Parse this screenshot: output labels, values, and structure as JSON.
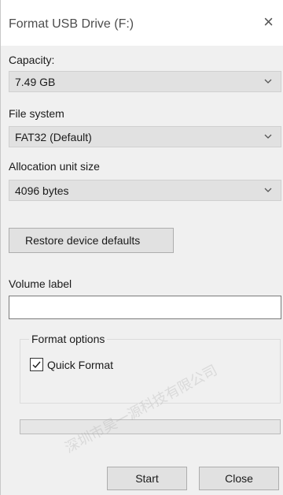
{
  "dialog": {
    "title": "Format USB Drive (F:)",
    "close_glyph": "×"
  },
  "capacity": {
    "label": "Capacity:",
    "value": "7.49 GB"
  },
  "file_system": {
    "label": "File system",
    "value": "FAT32 (Default)"
  },
  "allocation": {
    "label": "Allocation unit size",
    "value": "4096 bytes"
  },
  "restore_button": "Restore device defaults",
  "volume": {
    "label": "Volume label",
    "value": ""
  },
  "format_options": {
    "legend": "Format options",
    "quick_format_label": "Quick Format",
    "quick_format_checked": true
  },
  "progress": {
    "fraction": 0
  },
  "buttons": {
    "start": "Start",
    "close": "Close"
  },
  "watermark": {
    "text": "深圳市昊一源科技有限公司"
  },
  "icons": {
    "close": "close-icon",
    "chevron": "chevron-down-icon",
    "check": "checkmark-icon"
  }
}
